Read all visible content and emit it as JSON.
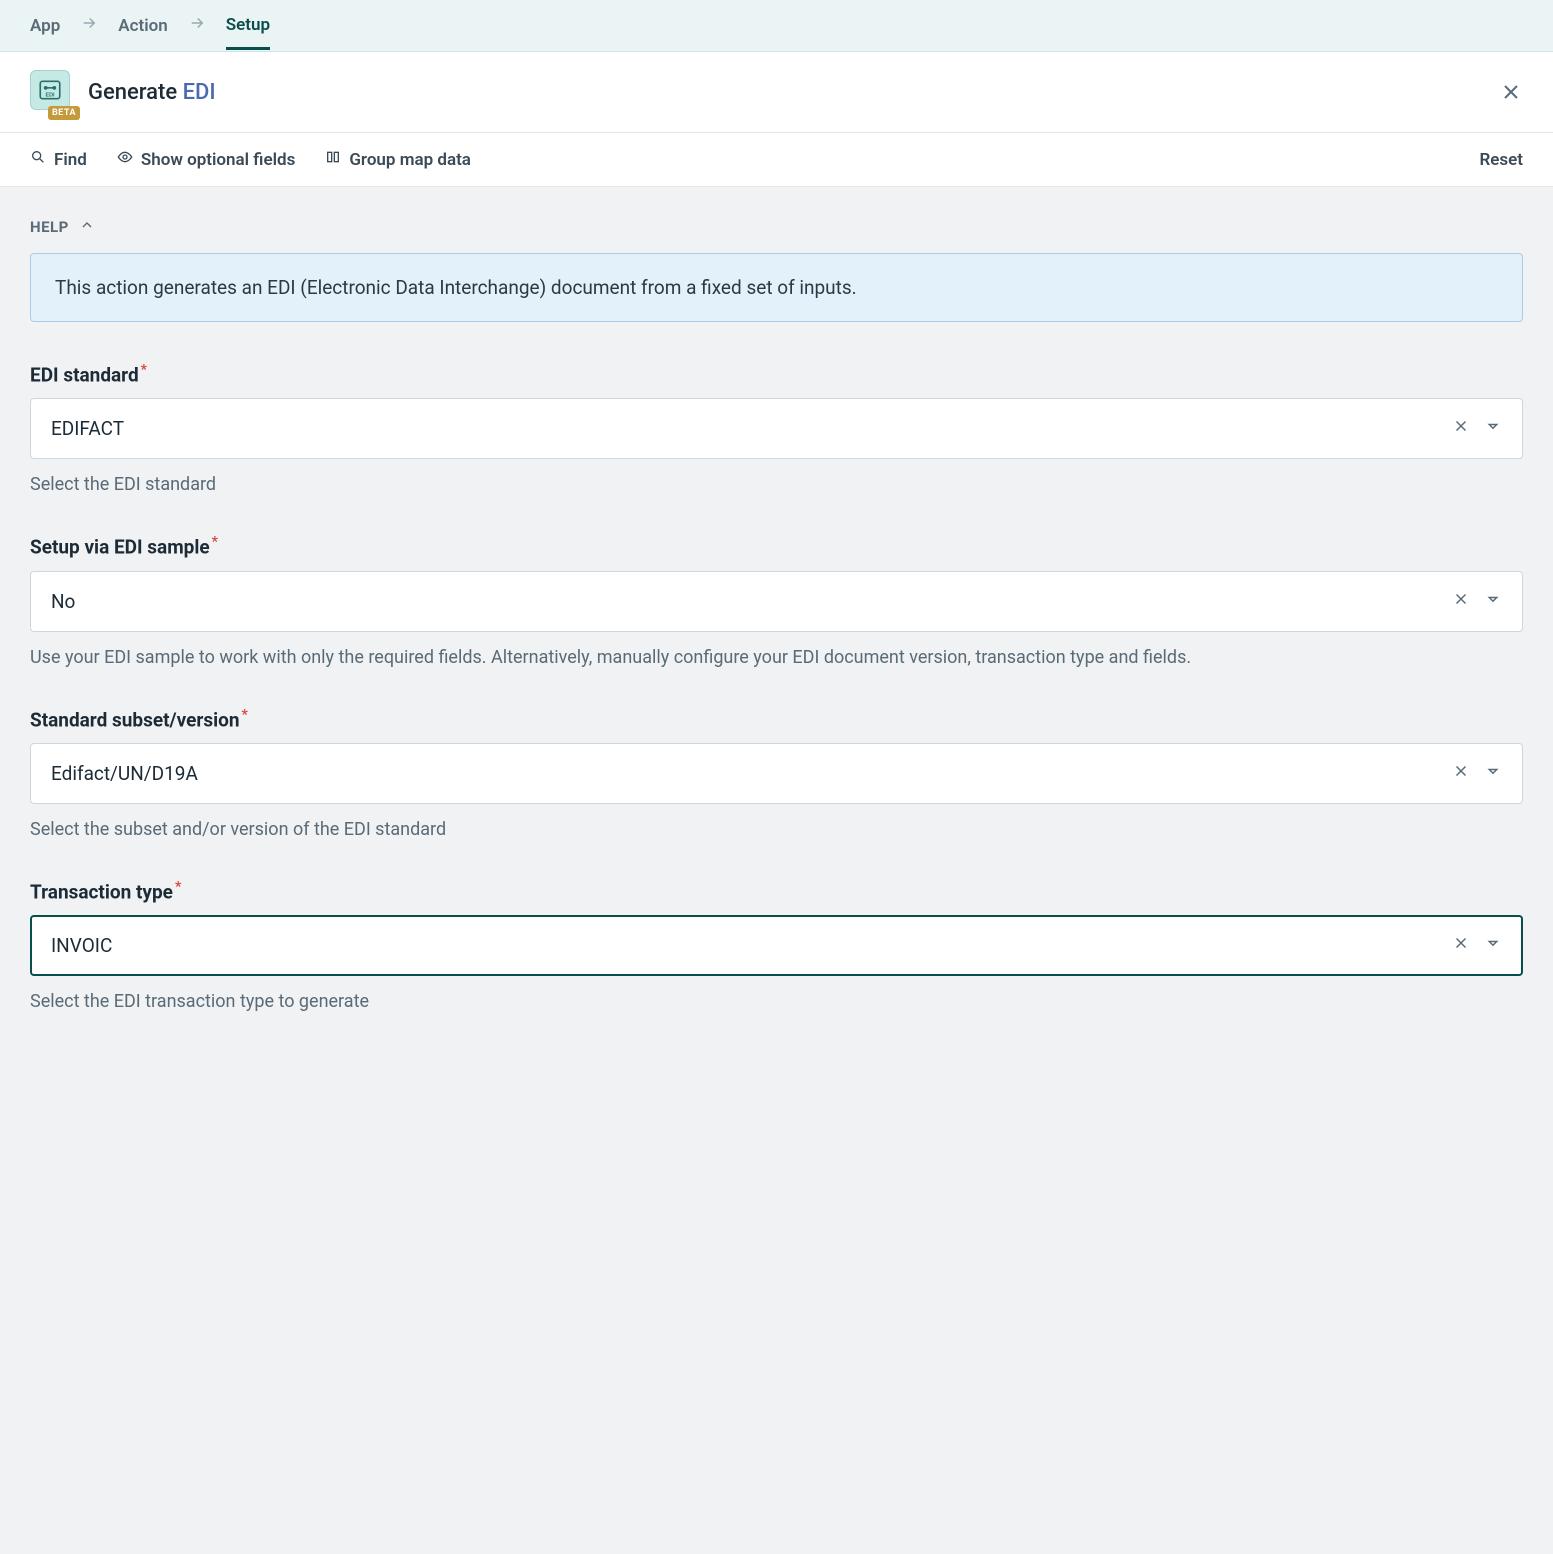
{
  "breadcrumbs": {
    "app": "App",
    "action": "Action",
    "setup": "Setup"
  },
  "header": {
    "title_prefix": "Generate ",
    "title_link": "EDI",
    "beta": "BETA"
  },
  "toolbar": {
    "find": "Find",
    "show_optional": "Show optional fields",
    "group_map": "Group map data",
    "reset": "Reset"
  },
  "help": {
    "label": "HELP",
    "text": "This action generates an EDI (Electronic Data Interchange) document from a fixed set of inputs."
  },
  "fields": {
    "edi_standard": {
      "label": "EDI standard",
      "value": "EDIFACT",
      "help": "Select the EDI standard"
    },
    "setup_via_sample": {
      "label": "Setup via EDI sample",
      "value": "No",
      "help": "Use your EDI sample to work with only the required fields. Alternatively, manually configure your EDI document version, transaction type and fields."
    },
    "standard_subset": {
      "label": "Standard subset/version",
      "value": "Edifact/UN/D19A",
      "help": "Select the subset and/or version of the EDI standard"
    },
    "transaction_type": {
      "label": "Transaction type",
      "value": "INVOIC",
      "help": "Select the EDI transaction type to generate"
    }
  }
}
